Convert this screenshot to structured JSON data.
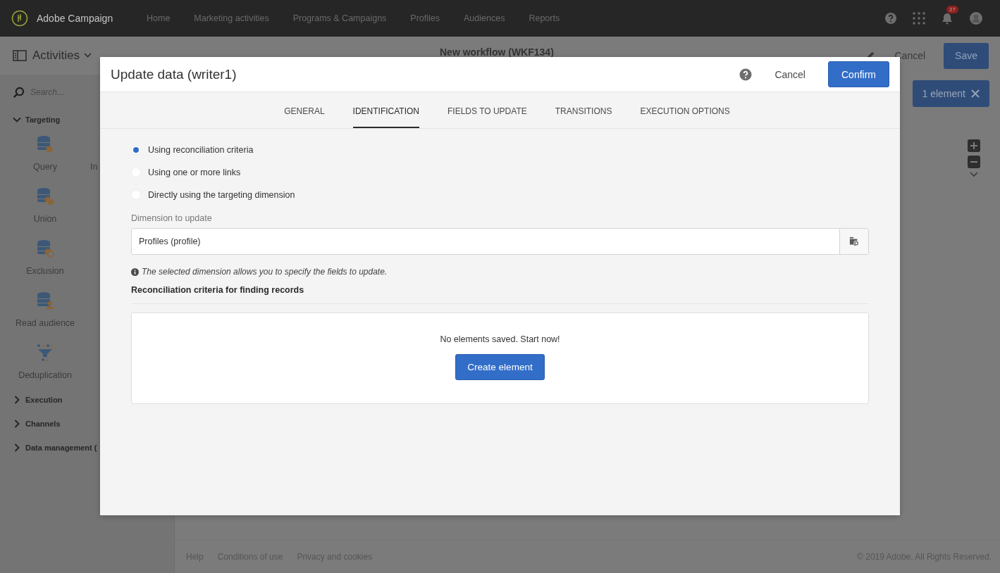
{
  "top_nav": {
    "brand": "Adobe Campaign",
    "items": [
      "Home",
      "Marketing activities",
      "Programs & Campaigns",
      "Profiles",
      "Audiences",
      "Reports"
    ],
    "notification_count": "27"
  },
  "toolbar": {
    "title": "Activities",
    "workflow": "New workflow (WKF134)",
    "cancel": "Cancel",
    "save": "Save",
    "selection": "1 element"
  },
  "sidebar": {
    "search": {
      "placeholder": "Search..."
    },
    "sections": [
      {
        "label": "Targeting",
        "expanded": true,
        "rows": [
          [
            {
              "label": "Query",
              "kind": "query"
            },
            {
              "label": "In",
              "kind": "hidden"
            }
          ],
          [
            {
              "label": "Union",
              "kind": "union"
            }
          ],
          [
            {
              "label": "Exclusion",
              "kind": "exclusion"
            }
          ],
          [
            {
              "label": "Read audience",
              "kind": "audience"
            }
          ],
          [
            {
              "label": "Deduplication",
              "kind": "dedup"
            }
          ]
        ]
      },
      {
        "label": "Execution",
        "expanded": false
      },
      {
        "label": "Channels",
        "expanded": false
      },
      {
        "label": "Data management (",
        "expanded": false
      }
    ]
  },
  "footer": {
    "links": [
      "Help",
      "Conditions of use",
      "Privacy and cookies"
    ],
    "copyright": "© 2019 Adobe. All Rights Reserved."
  },
  "dialog": {
    "title": "Update data (writer1)",
    "cancel": "Cancel",
    "confirm": "Confirm",
    "tabs": [
      {
        "label": "GENERAL",
        "selected": false
      },
      {
        "label": "IDENTIFICATION",
        "selected": true
      },
      {
        "label": "FIELDS TO UPDATE",
        "selected": false
      },
      {
        "label": "TRANSITIONS",
        "selected": false
      },
      {
        "label": "EXECUTION OPTIONS",
        "selected": false
      }
    ],
    "options": [
      {
        "label": "Using reconciliation criteria",
        "selected": true
      },
      {
        "label": "Using one or more links",
        "selected": false
      },
      {
        "label": "Directly using the targeting dimension",
        "selected": false
      }
    ],
    "dimension": {
      "label": "Dimension to update",
      "value": "Profiles (profile)",
      "hint": "The selected dimension allows you to specify the fields to update."
    },
    "criteria": {
      "title": "Reconciliation criteria for finding records",
      "empty_message": "No elements saved. Start now!",
      "create_button": "Create element"
    }
  }
}
